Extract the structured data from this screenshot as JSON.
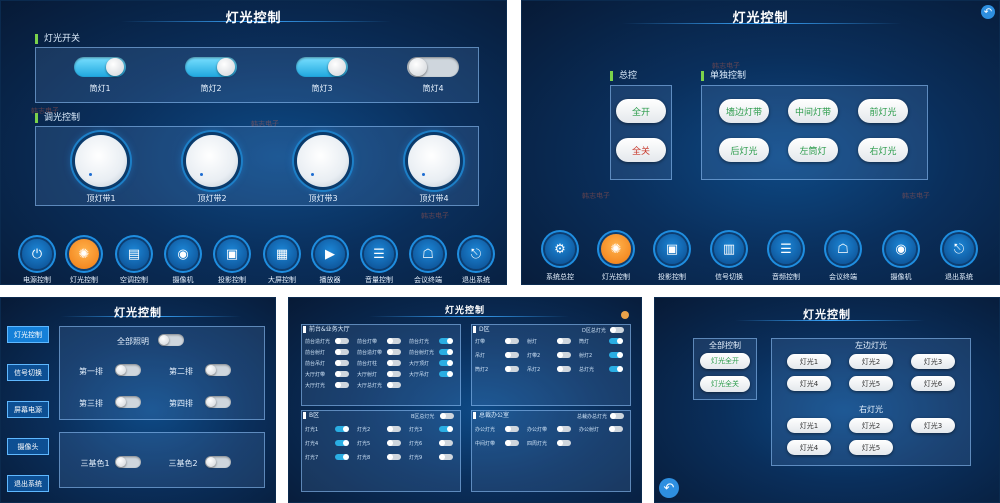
{
  "p1": {
    "title": "灯光控制",
    "sec1": "灯光开关",
    "sec2": "调光控制",
    "toggles": [
      "筒灯1",
      "筒灯2",
      "筒灯3",
      "筒灯4"
    ],
    "dials": [
      "顶灯带1",
      "顶灯带2",
      "顶灯带3",
      "顶灯带4"
    ],
    "nav": [
      "电源控制",
      "灯光控制",
      "空调控制",
      "摄像机",
      "投影控制",
      "大屏控制",
      "播放器",
      "音量控制",
      "会议终端",
      "退出系统"
    ]
  },
  "p2": {
    "title": "灯光控制",
    "master": "总控",
    "single": "单独控制",
    "all_on": "全开",
    "all_off": "全关",
    "lights": [
      "墙边灯带",
      "中间灯带",
      "前灯光",
      "后灯光",
      "左筒灯",
      "右灯光"
    ],
    "nav": [
      "系统总控",
      "灯光控制",
      "投影控制",
      "信号切换",
      "音频控制",
      "会议终端",
      "摄像机",
      "退出系统"
    ]
  },
  "p3": {
    "title": "灯光控制",
    "side": [
      "灯光控制",
      "信号切换",
      "屏幕电源",
      "摄像头",
      "退出系统"
    ],
    "all": "全部照明",
    "rows": [
      "第一排",
      "第二排",
      "第三排",
      "第四排"
    ],
    "colors": [
      "三基色1",
      "三基色2"
    ]
  },
  "p4": {
    "title": "灯光控制",
    "zones": [
      "前台&业务大厅",
      "D区",
      "B区",
      "总裁办公室"
    ],
    "zone_c": "B区总灯光",
    "zone_d": "D区总灯光",
    "zone_e": "总裁办总灯光",
    "items_a": [
      "前台造灯光",
      "前台灯带",
      "前台灯光",
      "前台射灯",
      "前台造灯带",
      "前台射灯光",
      "前台吊灯",
      "前台灯柱",
      "大厅顶灯",
      "大厅灯带",
      "大厅射灯",
      "大厅吊灯",
      "大厅灯光",
      "大厅总灯光"
    ],
    "items_b": [
      "灯带",
      "射灯",
      "筒灯",
      "吊灯",
      "灯带2",
      "射灯2",
      "筒灯2",
      "吊灯2",
      "总灯光"
    ],
    "items_c": [
      "灯光1",
      "灯光2",
      "灯光3",
      "灯光4",
      "灯光5",
      "灯光6",
      "灯光7",
      "灯光8",
      "灯光9"
    ],
    "items_d": [
      "办公灯光",
      "办公灯带",
      "办公射灯",
      "中间灯带",
      "四周灯光"
    ]
  },
  "p5": {
    "title": "灯光控制",
    "master": "全部控制",
    "all_on": "灯光全开",
    "all_off": "灯光全关",
    "left": "左边灯光",
    "right": "右灯光",
    "left_btns": [
      "灯光1",
      "灯光2",
      "灯光3",
      "灯光4",
      "灯光5",
      "灯光6"
    ],
    "right_btns": [
      "灯光1",
      "灯光2",
      "灯光3",
      "灯光4",
      "灯光5"
    ]
  },
  "watermark": "韩志电子"
}
